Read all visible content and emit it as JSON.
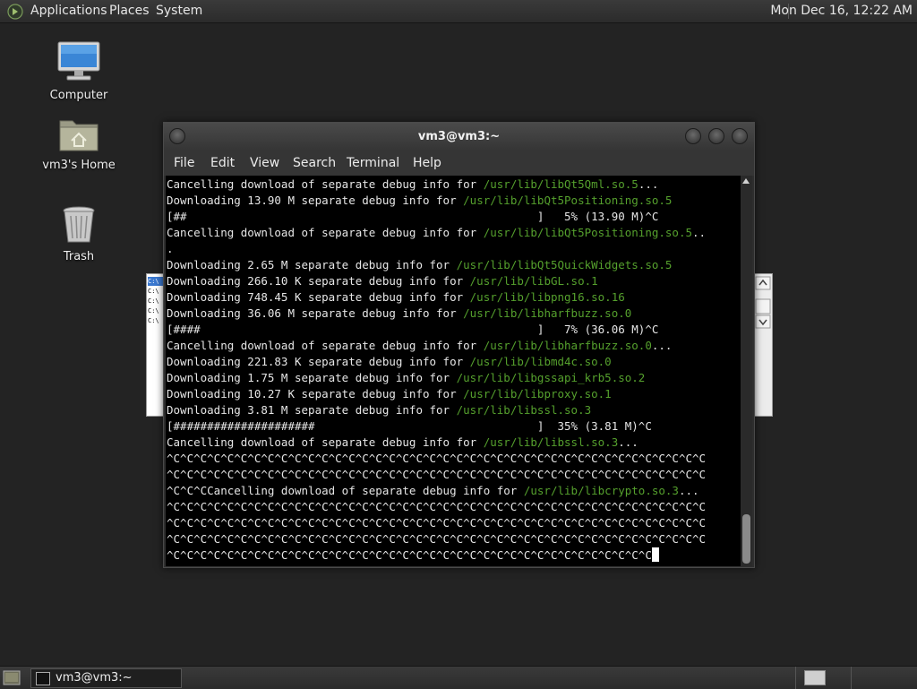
{
  "top_panel": {
    "menus": [
      "Applications",
      "Places",
      "System"
    ],
    "clock": "Mon Dec 16, 12:22 AM"
  },
  "desktop_icons": [
    {
      "label": "Computer",
      "icon": "computer-icon"
    },
    {
      "label": "vm3's Home",
      "icon": "home-folder-icon"
    },
    {
      "label": "Trash",
      "icon": "trash-icon"
    }
  ],
  "background_window": {
    "rows": [
      "C:\\",
      "C:\\",
      "C:\\",
      "C:\\",
      "C:\\"
    ]
  },
  "terminal": {
    "title": "vm3@vm3:~",
    "menu": [
      "File",
      "Edit",
      "View",
      "Search",
      "Terminal",
      "Help"
    ],
    "lines": [
      {
        "text": "Cancelling download of separate debug info for ",
        "path": "/usr/lib/libQt5Qml.so.5",
        "suffix": "..."
      },
      {
        "text": "Downloading 13.90 M separate debug info for ",
        "path": "/usr/lib/libQt5Positioning.so.5",
        "suffix": ""
      },
      {
        "text": "[##                                                    ]   5% (13.90 M)^C",
        "path": "",
        "suffix": ""
      },
      {
        "text": "Cancelling download of separate debug info for ",
        "path": "/usr/lib/libQt5Positioning.so.5",
        "suffix": ".."
      },
      {
        "text": ".",
        "path": "",
        "suffix": ""
      },
      {
        "text": "Downloading 2.65 M separate debug info for ",
        "path": "/usr/lib/libQt5QuickWidgets.so.5",
        "suffix": ""
      },
      {
        "text": "Downloading 266.10 K separate debug info for ",
        "path": "/usr/lib/libGL.so.1",
        "suffix": ""
      },
      {
        "text": "Downloading 748.45 K separate debug info for ",
        "path": "/usr/lib/libpng16.so.16",
        "suffix": ""
      },
      {
        "text": "Downloading 36.06 M separate debug info for ",
        "path": "/usr/lib/libharfbuzz.so.0",
        "suffix": ""
      },
      {
        "text": "[####                                                  ]   7% (36.06 M)^C",
        "path": "",
        "suffix": ""
      },
      {
        "text": "Cancelling download of separate debug info for ",
        "path": "/usr/lib/libharfbuzz.so.0",
        "suffix": "..."
      },
      {
        "text": "Downloading 221.83 K separate debug info for ",
        "path": "/usr/lib/libmd4c.so.0",
        "suffix": ""
      },
      {
        "text": "Downloading 1.75 M separate debug info for ",
        "path": "/usr/lib/libgssapi_krb5.so.2",
        "suffix": ""
      },
      {
        "text": "Downloading 10.27 K separate debug info for ",
        "path": "/usr/lib/libproxy.so.1",
        "suffix": ""
      },
      {
        "text": "Downloading 3.81 M separate debug info for ",
        "path": "/usr/lib/libssl.so.3",
        "suffix": ""
      },
      {
        "text": "[#####################                                 ]  35% (3.81 M)^C",
        "path": "",
        "suffix": ""
      },
      {
        "text": "Cancelling download of separate debug info for ",
        "path": "/usr/lib/libssl.so.3",
        "suffix": "..."
      },
      {
        "text": "^C^C^C^C^C^C^C^C^C^C^C^C^C^C^C^C^C^C^C^C^C^C^C^C^C^C^C^C^C^C^C^C^C^C^C^C^C^C^C^C",
        "path": "",
        "suffix": ""
      },
      {
        "text": "^C^C^C^C^C^C^C^C^C^C^C^C^C^C^C^C^C^C^C^C^C^C^C^C^C^C^C^C^C^C^C^C^C^C^C^C^C^C^C^C",
        "path": "",
        "suffix": ""
      },
      {
        "text": "^C^C^CCancelling download of separate debug info for ",
        "path": "/usr/lib/libcrypto.so.3",
        "suffix": "..."
      },
      {
        "text": "^C^C^C^C^C^C^C^C^C^C^C^C^C^C^C^C^C^C^C^C^C^C^C^C^C^C^C^C^C^C^C^C^C^C^C^C^C^C^C^C",
        "path": "",
        "suffix": ""
      },
      {
        "text": "^C^C^C^C^C^C^C^C^C^C^C^C^C^C^C^C^C^C^C^C^C^C^C^C^C^C^C^C^C^C^C^C^C^C^C^C^C^C^C^C",
        "path": "",
        "suffix": ""
      },
      {
        "text": "^C^C^C^C^C^C^C^C^C^C^C^C^C^C^C^C^C^C^C^C^C^C^C^C^C^C^C^C^C^C^C^C^C^C^C^C^C^C^C^C",
        "path": "",
        "suffix": ""
      },
      {
        "text": "^C^C^C^C^C^C^C^C^C^C^C^C^C^C^C^C^C^C^C^C^C^C^C^C^C^C^C^C^C^C^C^C^C^C^C^C",
        "path": "",
        "suffix": ""
      }
    ]
  },
  "taskbar": {
    "task_label": "vm3@vm3:~"
  },
  "colors": {
    "path_green": "#55a02d",
    "terminal_bg": "#000000",
    "desktop_bg": "#232323"
  }
}
